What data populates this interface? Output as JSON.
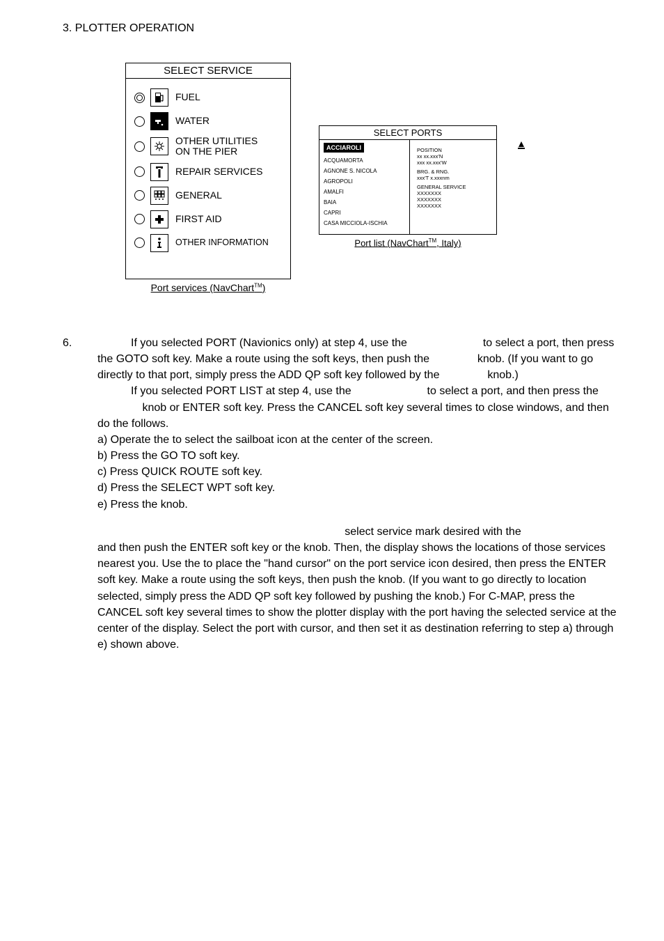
{
  "header": "3.  PLOTTER OPERATION",
  "select_service": {
    "title": "SELECT SERVICE",
    "items": [
      {
        "label": "FUEL",
        "selected": true
      },
      {
        "label": "WATER",
        "selected": false
      },
      {
        "label": "OTHER UTILITIES\nON THE PIER",
        "selected": false
      },
      {
        "label": "REPAIR SERVICES",
        "selected": false
      },
      {
        "label": "GENERAL",
        "selected": false
      },
      {
        "label": "FIRST AID",
        "selected": false
      },
      {
        "label": "OTHER INFORMATION",
        "selected": false
      }
    ],
    "caption_a": "Port services (NavChart",
    "caption_b": ")"
  },
  "select_ports": {
    "title": "SELECT PORTS",
    "selected": "ACCIAROLI",
    "list": [
      "ACQUAMORTA",
      "AGNONE S. NICOLA",
      "AGROPOLI",
      "AMALFI",
      "BAIA",
      "CAPRI",
      "CASA MICCIOLA-ISCHIA"
    ],
    "info": {
      "position_hdr": "POSITION",
      "position_l1": "xx xx.xxx'N",
      "position_l2": "xxx xx.xxx'W",
      "brg_hdr": "BRG. & RNG.",
      "brg_l1": "xxx'T   x.xxxnm",
      "svc_hdr": "GENERAL SERVICE",
      "svc_l1": "XXXXXXX",
      "svc_l2": "XXXXXXX",
      "svc_l3": "XXXXXXX"
    },
    "caption_a": "Port list (NavChart",
    "caption_b": ", Italy)"
  },
  "step6": {
    "num": "6.",
    "para1a": "If you selected PORT (Navionics only) at step 4, use the ",
    "para1b": " to select a port, then press the GOTO soft key. Make a route using the soft keys, then push the ",
    "para1c": " knob. (If you want to go directly to that port, simply press the ADD QP soft key followed by the ",
    "para1d": " knob.)",
    "para2a": "If you selected PORT LIST at step 4, use the ",
    "para2b": " to select a port, and then press the ",
    "para2c": " knob or ENTER soft key. Press the CANCEL soft key several times to close windows, and then do the follows.",
    "a": "a) Operate the                    to select the sailboat icon at the center of the screen.",
    "b": "b)    Press the GO TO soft key.",
    "c": "c)    Press QUICK ROUTE soft key.",
    "d": "d)    Press the SELECT WPT soft key.",
    "e": "e)    Press the               knob.",
    "para3a": "select service mark desired with the ",
    "para3b": "and then push the ENTER soft key or the              knob. Then, the display shows the locations of those services nearest you. Use the                    to place the \"hand cursor\" on the port service icon desired, then press the ENTER soft key. Make a route using the soft keys, then push the              knob. (If you want to go directly to location selected, simply press the ADD QP soft key followed by pushing the               knob.) For C-MAP, press the CANCEL soft key several times to show the plotter display with the port having the selected service at the center of the display. Select the port with cursor, and then set it as destination referring to step a) through e) shown above."
  }
}
